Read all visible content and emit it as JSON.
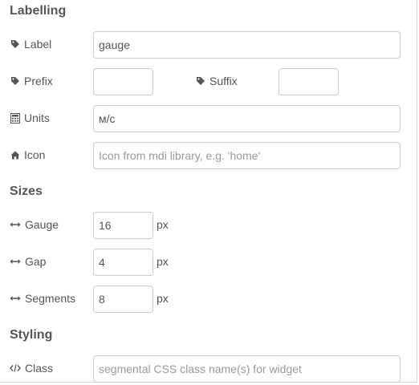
{
  "sections": {
    "labelling": "Labelling",
    "sizes": "Sizes",
    "styling": "Styling"
  },
  "labelling": {
    "label": {
      "text": "Label",
      "value": "gauge",
      "icon": "tag-icon"
    },
    "prefix": {
      "text": "Prefix",
      "value": "",
      "icon": "tag-icon"
    },
    "suffix": {
      "text": "Suffix",
      "value": "",
      "icon": "tag-icon"
    },
    "units": {
      "text": "Units",
      "value": "м/с",
      "icon": "calculator-icon"
    },
    "icon": {
      "text": "Icon",
      "value": "",
      "placeholder": "Icon from mdi library, e.g. 'home'",
      "icon": "home-icon"
    }
  },
  "sizes": {
    "unit": "px",
    "gauge": {
      "text": "Gauge",
      "value": "16",
      "icon": "arrows-h-icon"
    },
    "gap": {
      "text": "Gap",
      "value": "4",
      "icon": "arrows-h-icon"
    },
    "segments": {
      "text": "Segments",
      "value": "8",
      "icon": "arrows-h-icon"
    }
  },
  "styling": {
    "class": {
      "text": "Class",
      "value": "",
      "placeholder": "segmental CSS class name(s) for widget",
      "icon": "code-icon"
    }
  },
  "colors": {
    "text": "#555555",
    "border": "#cccccc",
    "placeholder": "#9a9a9a"
  }
}
